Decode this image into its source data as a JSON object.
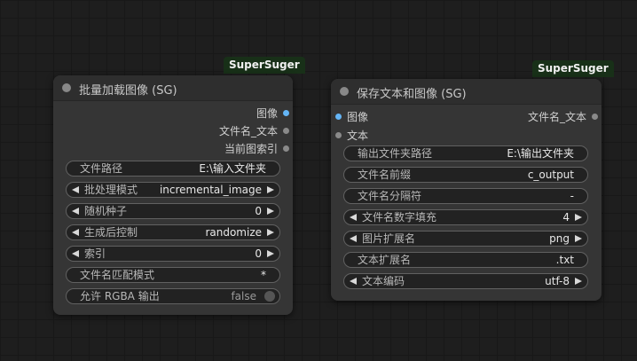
{
  "node1": {
    "badge": "SuperSuger",
    "title": "批量加载图像 (SG)",
    "outputs": [
      "图像",
      "文件名_文本",
      "当前图索引"
    ],
    "widgets": {
      "path": {
        "label": "文件路径",
        "value": "E:\\输入文件夹"
      },
      "mode": {
        "label": "批处理模式",
        "value": "incremental_image"
      },
      "seed": {
        "label": "随机种子",
        "value": "0"
      },
      "control": {
        "label": "生成后控制",
        "value": "randomize"
      },
      "index": {
        "label": "索引",
        "value": "0"
      },
      "pattern": {
        "label": "文件名匹配模式",
        "value": "*"
      },
      "rgba": {
        "label": "允许 RGBA 输出",
        "value": "false"
      }
    }
  },
  "node2": {
    "badge": "SuperSuger",
    "title": "保存文本和图像 (SG)",
    "inputs": [
      "图像",
      "文本"
    ],
    "outputs": [
      "文件名_文本"
    ],
    "widgets": {
      "outdir": {
        "label": "输出文件夹路径",
        "value": "E:\\输出文件夹"
      },
      "prefix": {
        "label": "文件名前缀",
        "value": "c_output"
      },
      "separator": {
        "label": "文件名分隔符",
        "value": "-"
      },
      "padding": {
        "label": "文件名数字填充",
        "value": "4"
      },
      "imgext": {
        "label": "图片扩展名",
        "value": "png"
      },
      "txtext": {
        "label": "文本扩展名",
        "value": ".txt"
      },
      "encoding": {
        "label": "文本编码",
        "value": "utf-8"
      }
    }
  },
  "colors": {
    "canvas": "#1e1e1e",
    "node_body": "#353535",
    "node_header": "#2e2e2e",
    "badge_bg": "#183018",
    "image_slot": "#64b5f6",
    "default_slot": "#8a8a8a"
  }
}
